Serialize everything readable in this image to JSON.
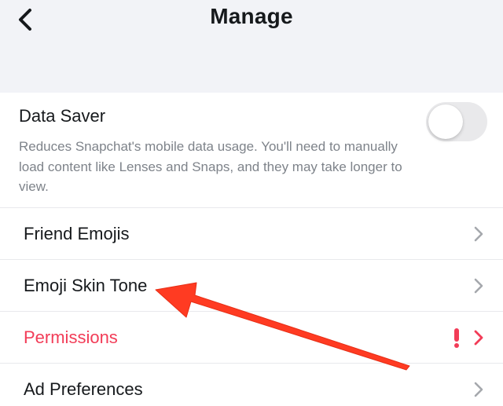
{
  "header": {
    "title": "Manage",
    "back_icon": "chevron-left-icon"
  },
  "data_saver": {
    "title": "Data Saver",
    "description": "Reduces Snapchat's mobile data usage. You'll need to manually load content like Lenses and Snaps, and they may take longer to view.",
    "toggle_on": false
  },
  "rows": [
    {
      "label": "Friend Emojis",
      "icon": "chevron-right-icon"
    },
    {
      "label": "Emoji Skin Tone",
      "icon": "chevron-right-icon"
    },
    {
      "label": "Permissions",
      "icon": "chevron-right-icon",
      "alert_icon": "exclamation-icon",
      "style": "danger"
    },
    {
      "label": "Ad Preferences",
      "icon": "chevron-right-icon"
    }
  ],
  "colors": {
    "background": "#F2F3F7",
    "surface": "#FFFFFF",
    "text_primary": "#16191C",
    "text_secondary": "#7E838A",
    "danger": "#F23C57",
    "annotation_arrow": "#FF3B22",
    "chevron": "#A5A8AD"
  },
  "annotation": {
    "type": "arrow",
    "points_to": "Emoji Skin Tone"
  }
}
